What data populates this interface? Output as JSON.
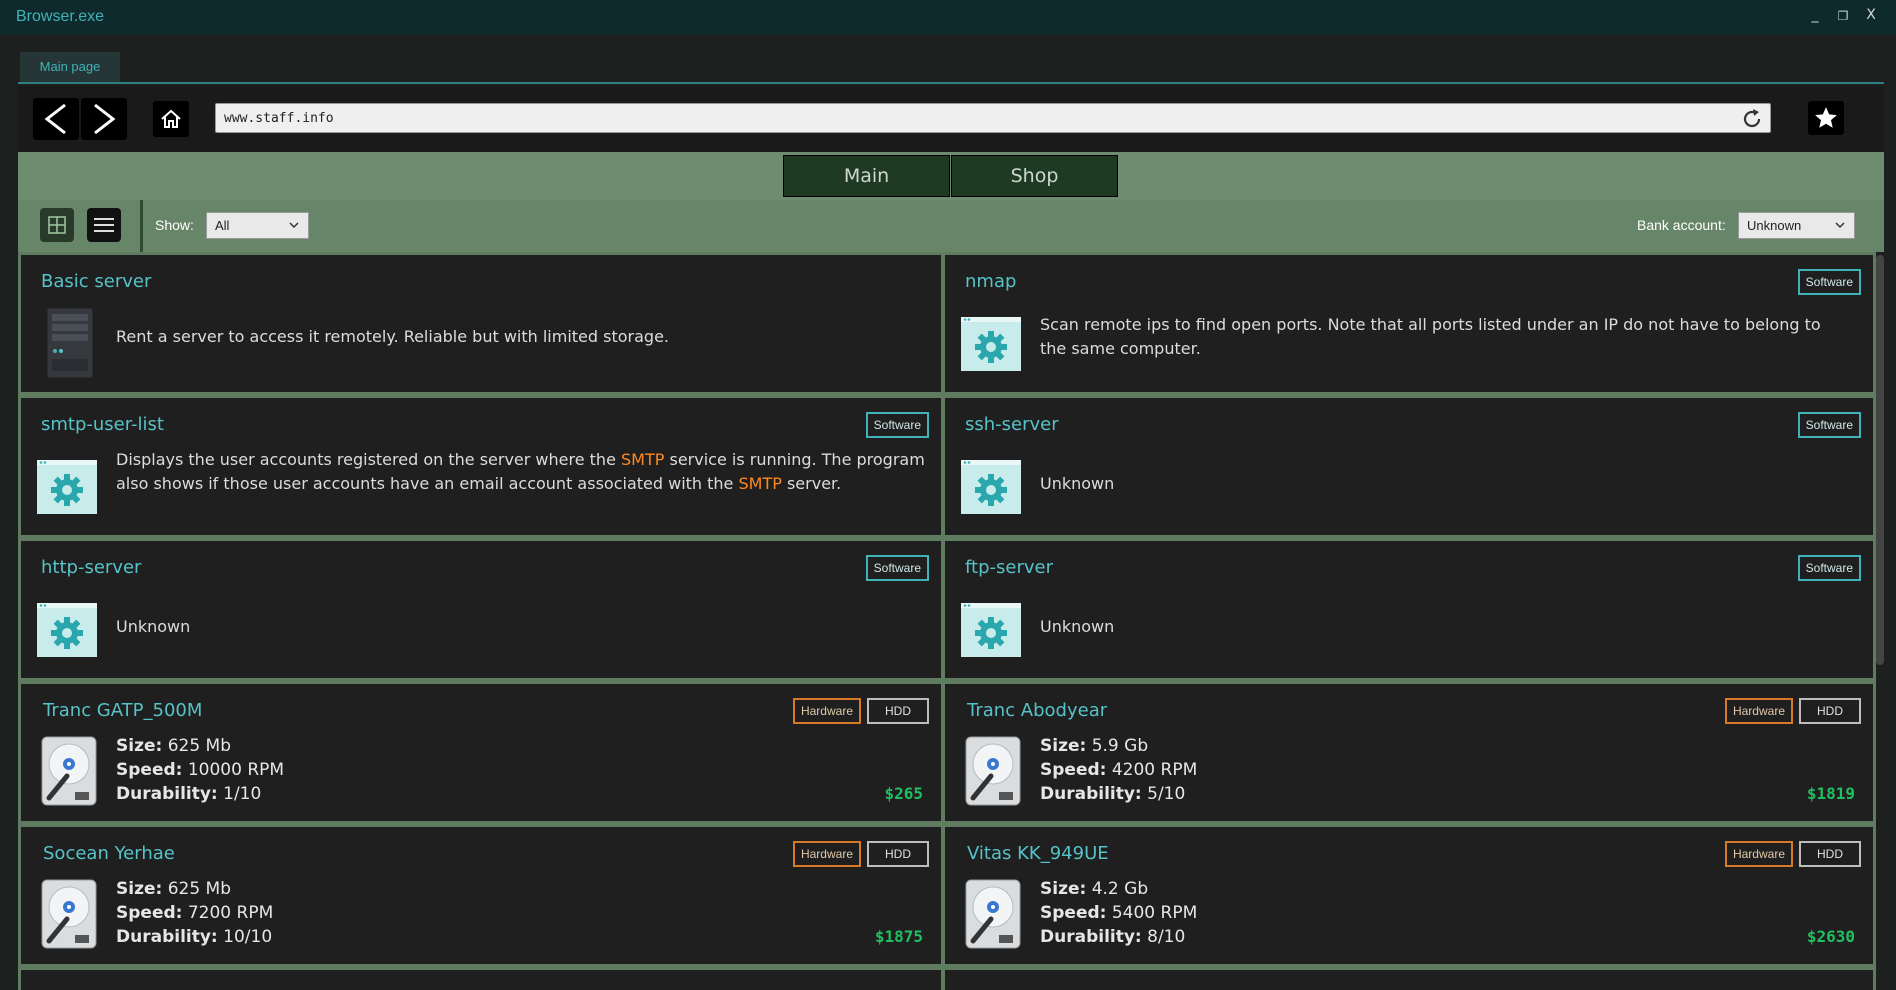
{
  "window": {
    "title": "Browser.exe",
    "minimize": "_",
    "restore": "❐",
    "close": "X"
  },
  "tabs": [
    {
      "label": "Main page"
    }
  ],
  "nav": {
    "url": "www.staff.info"
  },
  "site": {
    "tabs": [
      {
        "label": "Main"
      },
      {
        "label": "Shop"
      }
    ]
  },
  "filters": {
    "show_label": "Show:",
    "show_value": "All",
    "bank_label": "Bank account:",
    "bank_value": "Unknown"
  },
  "colors": {
    "accent": "#56c3c8",
    "highlight": "#ff8a1f",
    "price": "#20c060",
    "header_green": "#6e8d70"
  },
  "items": [
    {
      "title": "Basic server",
      "badges": [],
      "desc_parts": [
        "Rent a server to access it remotely. Reliable but with limited storage."
      ],
      "icon": "server-icon"
    },
    {
      "title": "nmap",
      "badges": [
        "Software"
      ],
      "desc_parts": [
        "Scan remote ips to find open ports.  Note that all ports listed under an IP do not have to belong to the same computer."
      ],
      "icon": "gear-icon"
    },
    {
      "title": "smtp-user-list",
      "badges": [
        "Software"
      ],
      "desc_parts": [
        "Displays the user accounts registered on the server where the ",
        "SMTP",
        " service is running. The program also shows if those user accounts have an email account associated with the ",
        "SMTP",
        " server."
      ],
      "icon": "gear-icon"
    },
    {
      "title": "ssh-server",
      "badges": [
        "Software"
      ],
      "desc_parts": [
        "Unknown"
      ],
      "icon": "gear-icon"
    },
    {
      "title": "http-server",
      "badges": [
        "Software"
      ],
      "desc_parts": [
        "Unknown"
      ],
      "icon": "gear-icon"
    },
    {
      "title": "ftp-server",
      "badges": [
        "Software"
      ],
      "desc_parts": [
        "Unknown"
      ],
      "icon": "gear-icon"
    },
    {
      "title": "Tranc GATP_500M",
      "badges": [
        "Hardware",
        "HDD"
      ],
      "size_label": "Size:",
      "size": "625 Mb",
      "speed_label": "Speed:",
      "speed": "10000 RPM",
      "durability_label": "Durability:",
      "durability": "1/10",
      "price": "$265",
      "icon": "hdd-icon"
    },
    {
      "title": "Tranc Abodyear",
      "badges": [
        "Hardware",
        "HDD"
      ],
      "size_label": "Size:",
      "size": "5.9 Gb",
      "speed_label": "Speed:",
      "speed": "4200 RPM",
      "durability_label": "Durability:",
      "durability": "5/10",
      "price": "$1819",
      "icon": "hdd-icon"
    },
    {
      "title": "Socean Yerhae",
      "badges": [
        "Hardware",
        "HDD"
      ],
      "size_label": "Size:",
      "size": "625 Mb",
      "speed_label": "Speed:",
      "speed": "7200 RPM",
      "durability_label": "Durability:",
      "durability": "10/10",
      "price": "$1875",
      "icon": "hdd-icon"
    },
    {
      "title": "Vitas KK_949UE",
      "badges": [
        "Hardware",
        "HDD"
      ],
      "size_label": "Size:",
      "size": "4.2 Gb",
      "speed_label": "Speed:",
      "speed": "5400 RPM",
      "durability_label": "Durability:",
      "durability": "8/10",
      "price": "$2630",
      "icon": "hdd-icon"
    }
  ]
}
